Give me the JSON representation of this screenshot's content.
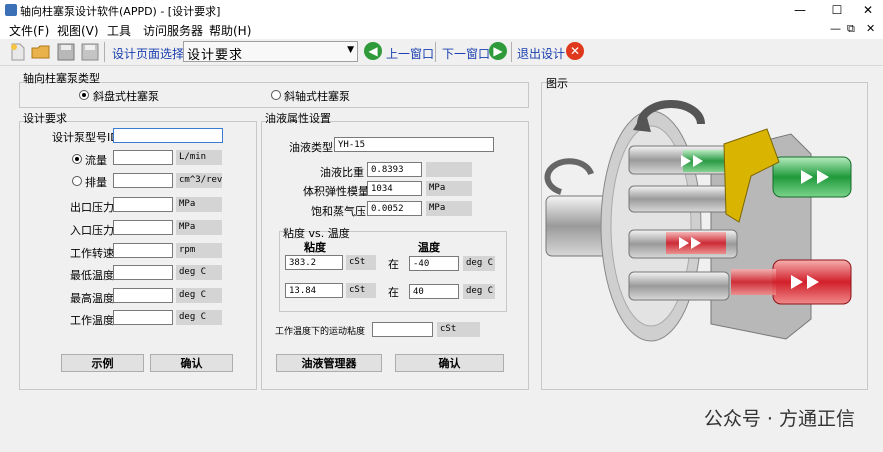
{
  "window": {
    "title": "轴向柱塞泵设计软件(APPD) - [设计要求]",
    "min": "—",
    "max": "☐",
    "close": "✕"
  },
  "menubar": {
    "items": [
      "文件(F)",
      "视图(V)",
      "工具",
      "访问服务器",
      "帮助(H)"
    ],
    "mdi_controls": [
      "—",
      "⧉",
      "✕"
    ]
  },
  "toolbar": {
    "page_select_label": "设计页面选择",
    "page_select_value": "设计要求",
    "prev_label": "上一窗口",
    "next_label": "下一窗口",
    "exit_label": "退出设计"
  },
  "pump_type": {
    "title": "轴向柱塞泵类型",
    "options": [
      "斜盘式柱塞泵",
      "斜轴式柱塞泵"
    ],
    "selected": "斜盘式柱塞泵"
  },
  "design_req": {
    "title": "设计要求",
    "model_id_label": "设计泵型号ID",
    "model_id_value": "",
    "flow_label": "流量",
    "flow_value": "",
    "flow_unit": "L/min",
    "disp_label": "排量",
    "disp_value": "",
    "disp_unit": "cm^3/rev",
    "flow_mode": "流量",
    "outlet_label": "出口压力",
    "outlet_value": "",
    "outlet_unit": "MPa",
    "inlet_label": "入口压力",
    "inlet_value": "",
    "inlet_unit": "MPa",
    "speed_label": "工作转速",
    "speed_value": "",
    "speed_unit": "rpm",
    "min_temp_label": "最低温度",
    "min_temp_value": "",
    "min_temp_unit": "deg C",
    "max_temp_label": "最高温度",
    "max_temp_value": "",
    "max_temp_unit": "deg C",
    "work_temp_label": "工作温度",
    "work_temp_value": "",
    "work_temp_unit": "deg C",
    "example_btn": "示例",
    "confirm_btn": "确认"
  },
  "oil": {
    "title": "油液属性设置",
    "type_label": "油液类型",
    "type_value": "YH-15",
    "density_label": "油液比重",
    "density_value": "0.8393",
    "density_unit": "",
    "bulk_label": "体积弹性模量",
    "bulk_value": "1034",
    "bulk_unit": "MPa",
    "vapor_label": "饱和蒸气压",
    "vapor_value": "0.0052",
    "vapor_unit": "MPa",
    "visc_group_title": "粘度 vs. 温度",
    "visc_header": "粘度",
    "temp_header": "温度",
    "at_label": "在",
    "rows": [
      {
        "visc": "383.2",
        "visc_unit": "cSt",
        "temp": "-40",
        "temp_unit": "deg C"
      },
      {
        "visc": "13.84",
        "visc_unit": "cSt",
        "temp": "40",
        "temp_unit": "deg C"
      }
    ],
    "work_visc_label": "工作温度下的运动粘度",
    "work_visc_value": "",
    "work_visc_unit": "cSt",
    "manager_btn": "油液管理器",
    "confirm_btn": "确认"
  },
  "illustration": {
    "title": "图示"
  },
  "watermark": "公众号 · 方通正信",
  "colors": {
    "toolbar_text": "#1a3fb0",
    "nav_green": "#2f9a3a",
    "exit_red": "#e0381c"
  }
}
